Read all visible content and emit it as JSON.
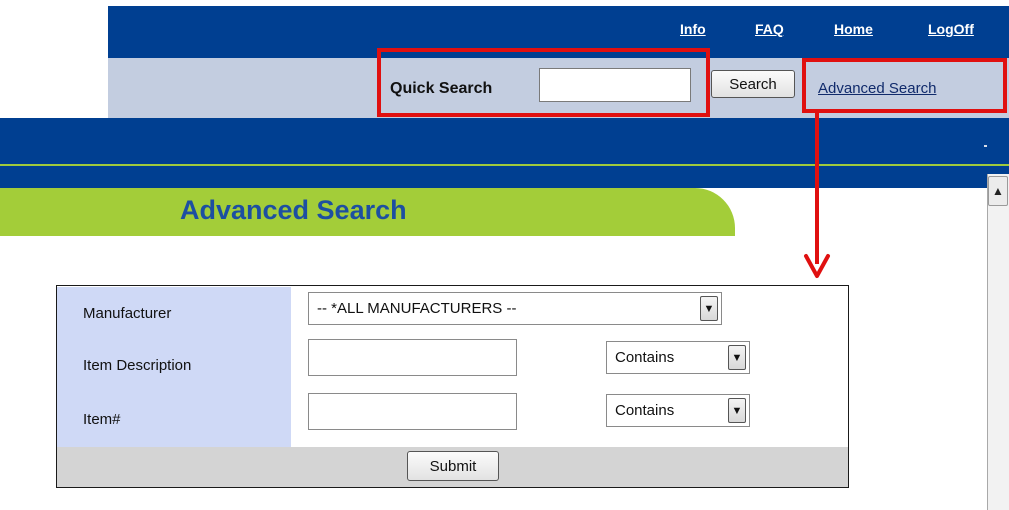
{
  "nav": {
    "links": [
      {
        "label": "Info"
      },
      {
        "label": "FAQ"
      },
      {
        "label": "Home"
      },
      {
        "label": "LogOff"
      }
    ]
  },
  "search": {
    "label": "Quick Search",
    "value": "",
    "button": "Search",
    "advanced_link": "Advanced Search"
  },
  "page": {
    "title": "Advanced Search"
  },
  "form": {
    "manufacturer_label": "Manufacturer",
    "manufacturer_value": "-- *ALL MANUFACTURERS --",
    "item_description_label": "Item Description",
    "item_description_value": "",
    "item_description_match": "Contains",
    "item_no_label": "Item#",
    "item_no_value": "",
    "item_no_match": "Contains",
    "submit_label": "Submit"
  },
  "colors": {
    "nav_blue": "#003f91",
    "search_bar": "#c3cde0",
    "tab_green": "#a3cd39",
    "title_blue": "#1d4fa1",
    "label_cell": "#cfd9f6",
    "annotation_red": "#e01010"
  },
  "icons": {
    "dropdown": "chevron-down-icon",
    "scroll_up": "chevron-up-icon",
    "annotation_arrow": "arrow-down-icon"
  }
}
